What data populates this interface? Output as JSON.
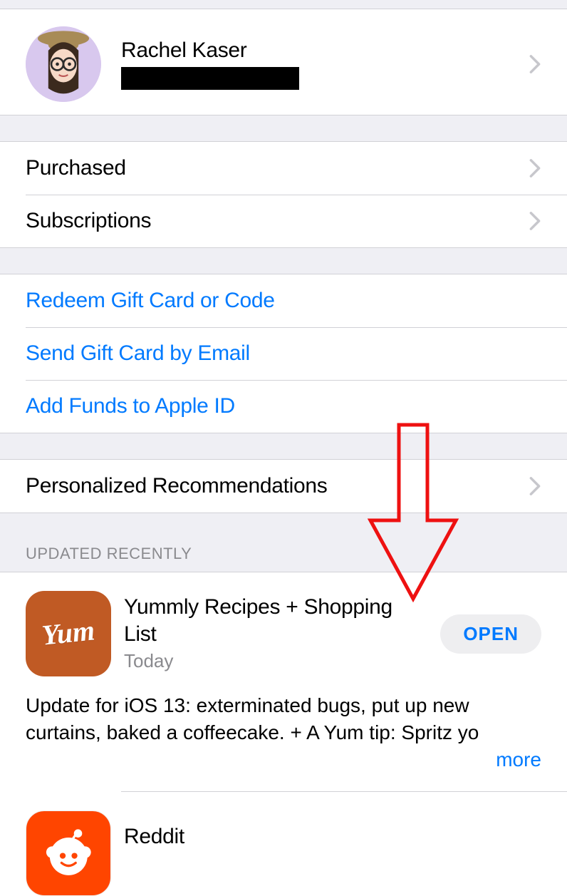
{
  "profile": {
    "name": "Rachel Kaser"
  },
  "account_rows": [
    {
      "label": "Purchased"
    },
    {
      "label": "Subscriptions"
    }
  ],
  "link_rows": [
    {
      "label": "Redeem Gift Card or Code"
    },
    {
      "label": "Send Gift Card by Email"
    },
    {
      "label": "Add Funds to Apple ID"
    }
  ],
  "recommendations_row": {
    "label": "Personalized Recommendations"
  },
  "updated_header": "Updated Recently",
  "apps": [
    {
      "icon_text": "Yum",
      "title": "Yummly Recipes + Shopping List",
      "date": "Today",
      "open_label": "OPEN",
      "description": "Update for iOS 13: exterminated bugs, put up new curtains, baked a coffeecake. + A Yum tip: Spritz yo",
      "more_label": "more"
    },
    {
      "title": "Reddit"
    }
  ]
}
